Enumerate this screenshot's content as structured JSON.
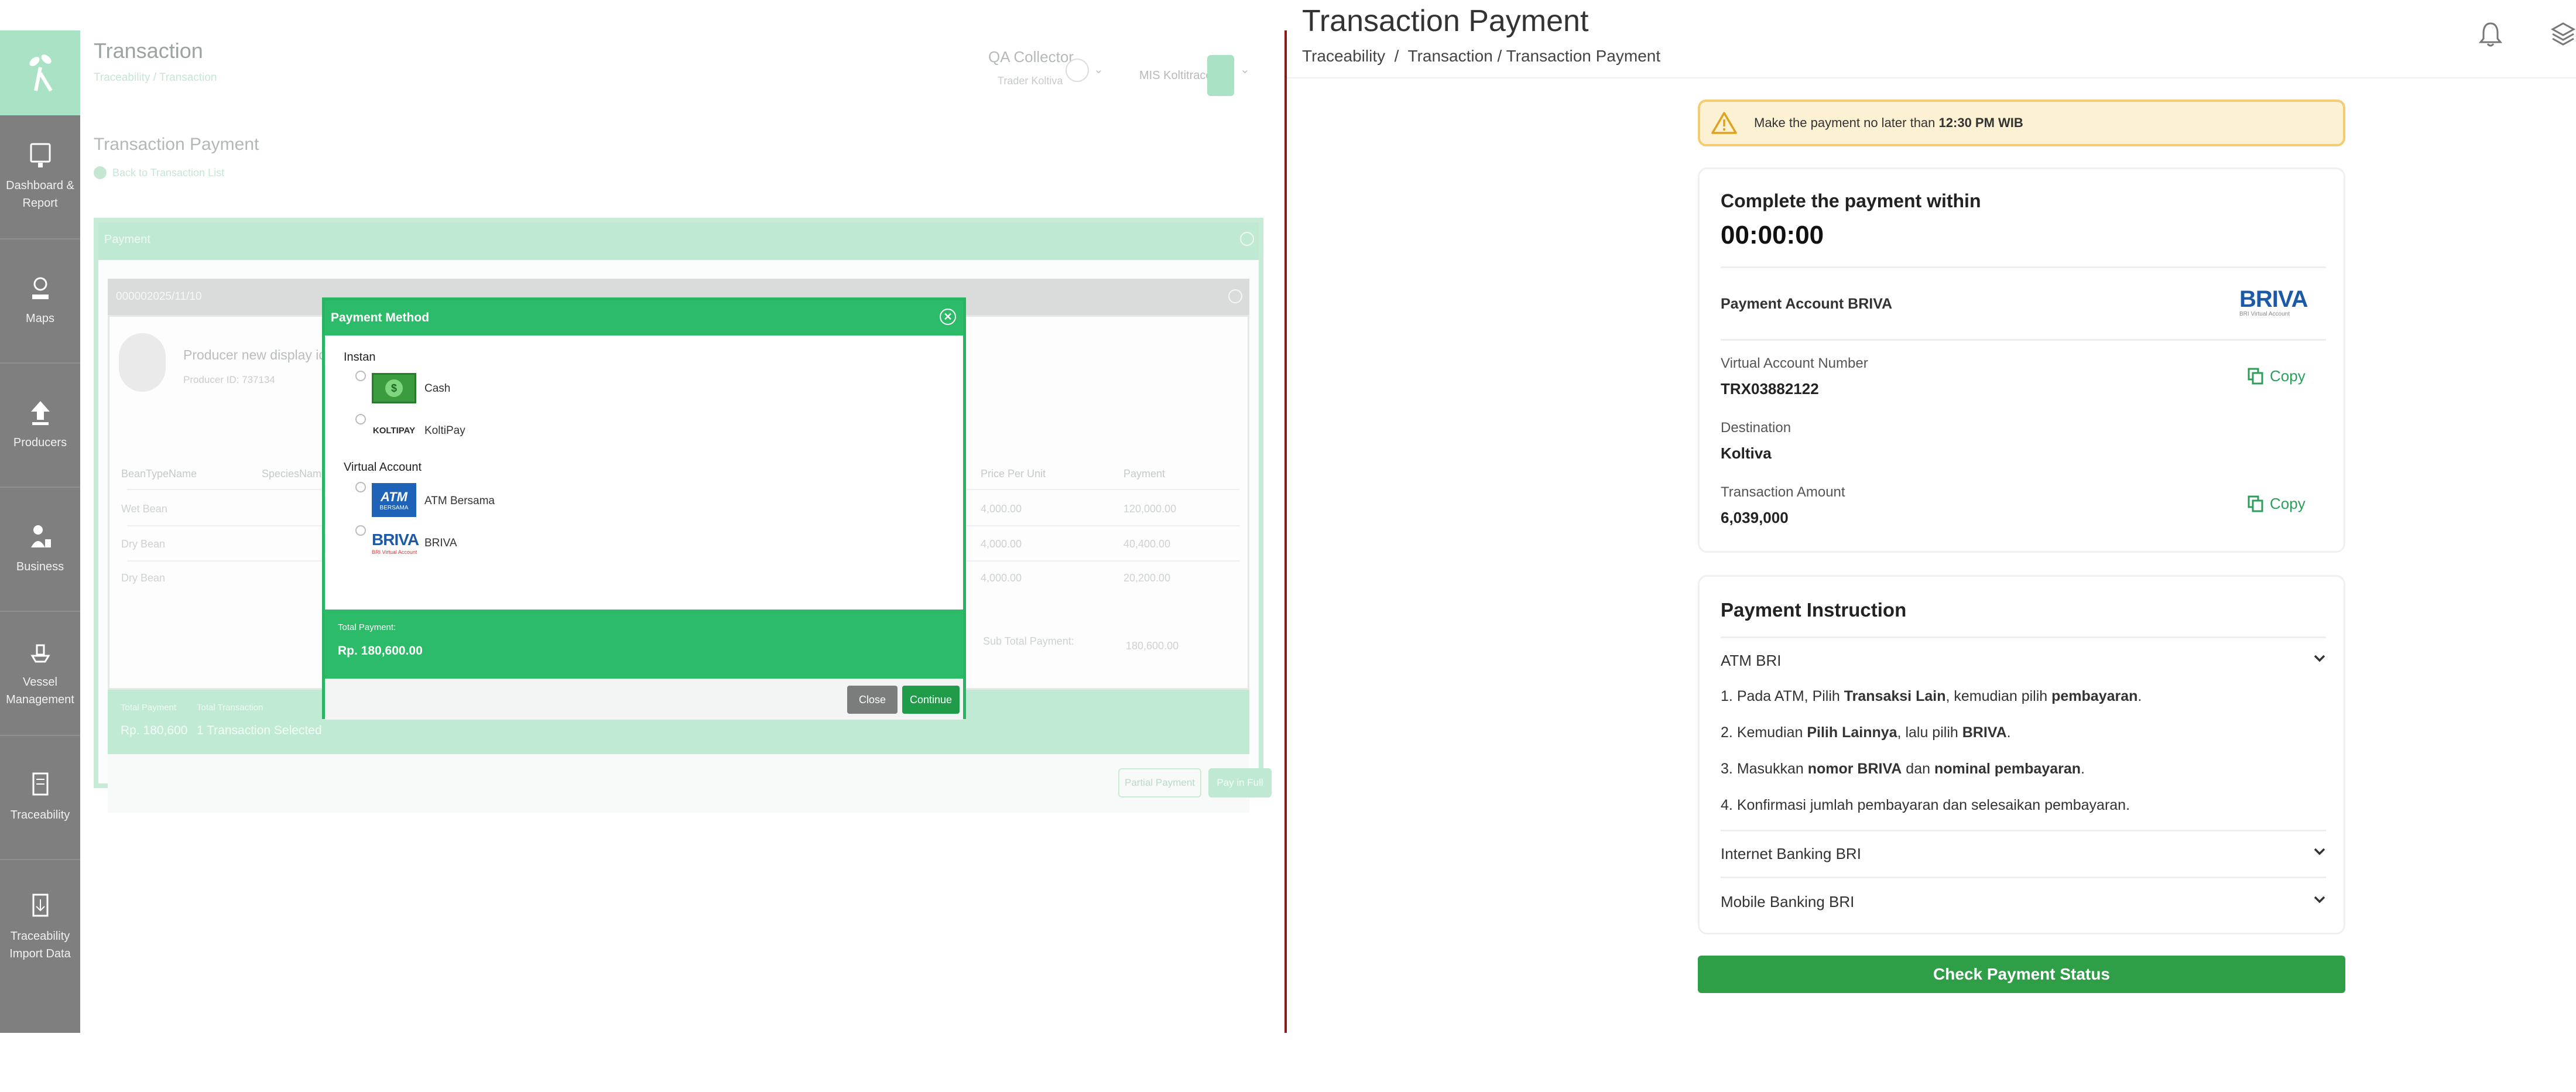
{
  "left_app": {
    "header": {
      "title": "Transaction",
      "breadcrumb": "Traceability / Transaction",
      "user_role": "QA Collector",
      "user_org": "Trader Koltiva",
      "account": "MIS Koltitrace"
    },
    "sidebar": {
      "items": [
        {
          "label": "Dashboard & Report",
          "icon": "monitor-icon"
        },
        {
          "label": "Maps",
          "icon": "map-pin-icon"
        },
        {
          "label": "Producers",
          "icon": "upload-icon"
        },
        {
          "label": "Business",
          "icon": "business-icon"
        },
        {
          "label": "Vessel Management",
          "icon": "ship-icon"
        },
        {
          "label": "Traceability",
          "icon": "document-icon"
        },
        {
          "label": "Traceability Import Data",
          "icon": "import-icon"
        }
      ]
    },
    "page_title": "Transaction Payment",
    "back_link": "Back to Transaction List",
    "panel_title": "Payment",
    "order_id": "000002025/11/10",
    "producer": {
      "name": "Producer new display id 280720",
      "id": "Producer ID: 737134"
    },
    "table": {
      "headers": [
        "BeanTypeName",
        "SpeciesName",
        "Price Per Unit",
        "Payment"
      ],
      "rows": [
        {
          "bean": "Wet Bean",
          "price": "4,000.00",
          "payment": "120,000.00"
        },
        {
          "bean": "Dry Bean",
          "price": "4,000.00",
          "payment": "40,400.00"
        },
        {
          "bean": "Dry Bean",
          "price": "4,000.00",
          "payment": "20,200.00"
        }
      ],
      "subtotal_label": "Sub Total Payment:",
      "subtotal_value": "180,600.00"
    },
    "footer": {
      "total_payment_label": "Total Payment",
      "total_payment_value": "Rp. 180,600",
      "total_transaction_label": "Total Transaction",
      "total_transaction_value": "1 Transaction Selected",
      "partial_label": "Partial Payment",
      "full_label": "Pay in Full"
    },
    "modal": {
      "title": "Payment Method",
      "groups": [
        {
          "title": "Instan",
          "options": [
            {
              "label": "Cash",
              "logo": "cash-logo"
            },
            {
              "label": "KoltiPay",
              "logo": "koltipay-logo",
              "logo_text": "KOLTIPAY"
            }
          ]
        },
        {
          "title": "Virtual Account",
          "options": [
            {
              "label": "ATM Bersama",
              "logo": "atm-bersama-logo",
              "logo_text": "ATM",
              "logo_subtext": "BERSAMA"
            },
            {
              "label": "BRIVA",
              "logo": "briva-logo",
              "logo_text": "BRIVA",
              "logo_subtext": "BRI Virtual Account"
            }
          ]
        }
      ],
      "total_label": "Total Payment:",
      "total_value": "Rp. 180,600.00",
      "close_label": "Close",
      "continue_label": "Continue"
    }
  },
  "right_app": {
    "title": "Transaction Payment",
    "breadcrumb": "Traceability  /  Transaction / Transaction Payment",
    "warning": {
      "text": "Make the payment no later than",
      "time": "12:30 PM WIB"
    },
    "countdown": {
      "heading": "Complete the payment within",
      "value": "00:00:00"
    },
    "payment_account": {
      "label": "Payment Account BRIVA",
      "logo_text": "BRIVA",
      "logo_subtext": "BRI Virtual Account"
    },
    "details": {
      "va_label": "Virtual Account Number",
      "va_value": "TRX03882122",
      "dest_label": "Destination",
      "dest_value": "Koltiva",
      "amount_label": "Transaction Amount",
      "amount_value": "6,039,000",
      "copy_label": "Copy"
    },
    "instructions": {
      "heading": "Payment Instruction",
      "sections": [
        {
          "title": "ATM BRI",
          "expanded": true
        },
        {
          "title": "Internet Banking BRI",
          "expanded": false
        },
        {
          "title": "Mobile Banking BRI",
          "expanded": false
        }
      ],
      "steps": [
        {
          "n": "1.",
          "parts": [
            "Pada ATM, Pilih ",
            "Transaksi Lain",
            ", kemudian pilih ",
            "pembayaran",
            "."
          ]
        },
        {
          "n": "2.",
          "parts": [
            "Kemudian ",
            "Pilih Lainnya",
            ", lalu pilih ",
            "BRIVA",
            "."
          ]
        },
        {
          "n": "3.",
          "parts": [
            "Masukkan ",
            "nomor BRIVA",
            " dan ",
            "nominal pembayaran",
            "."
          ]
        },
        {
          "n": "4.",
          "parts": [
            "Konfirmasi jumlah pembayaran dan selesaikan pembayaran.",
            "",
            "",
            "",
            ""
          ]
        }
      ]
    },
    "check_button": "Check Payment Status"
  },
  "colors": {
    "brand_green": "#2cbb68",
    "button_green": "#2e9e47",
    "warning_bg": "#fdf1d3",
    "warning_border": "#f4cc74",
    "briva_blue": "#1c5aa8"
  }
}
